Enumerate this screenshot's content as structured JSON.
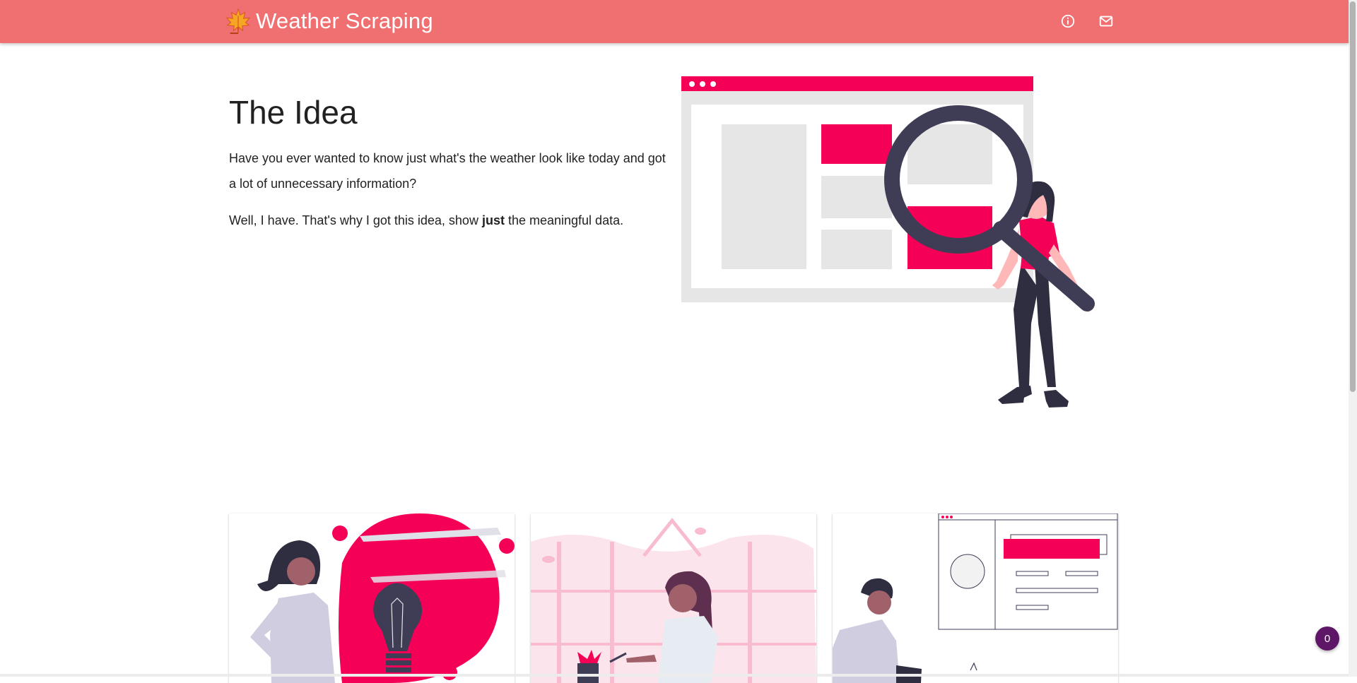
{
  "app": {
    "title": "Weather Scraping",
    "logo_icon": "maple-leaf-icon"
  },
  "header": {
    "actions": [
      {
        "icon": "info-icon",
        "label": "About"
      },
      {
        "icon": "mail-icon",
        "label": "Contact"
      }
    ]
  },
  "idea": {
    "title": "The Idea",
    "paragraph1": "Have you ever wanted to know just what's the weather look like today and got a lot of unnecessary information?",
    "paragraph2_before": "Well, I have. That's why I got this idea, show ",
    "paragraph2_bold": "just",
    "paragraph2_after": " the meaningful data."
  },
  "cards": [
    {
      "illustration": "idea-lightbulb-illustration"
    },
    {
      "illustration": "woman-writing-illustration"
    },
    {
      "illustration": "man-dashboard-illustration"
    }
  ],
  "chat": {
    "count": "0"
  },
  "colors": {
    "header": "#f07072",
    "accent": "#f50057",
    "dark": "#3f3d56",
    "badge": "#5e1766"
  }
}
